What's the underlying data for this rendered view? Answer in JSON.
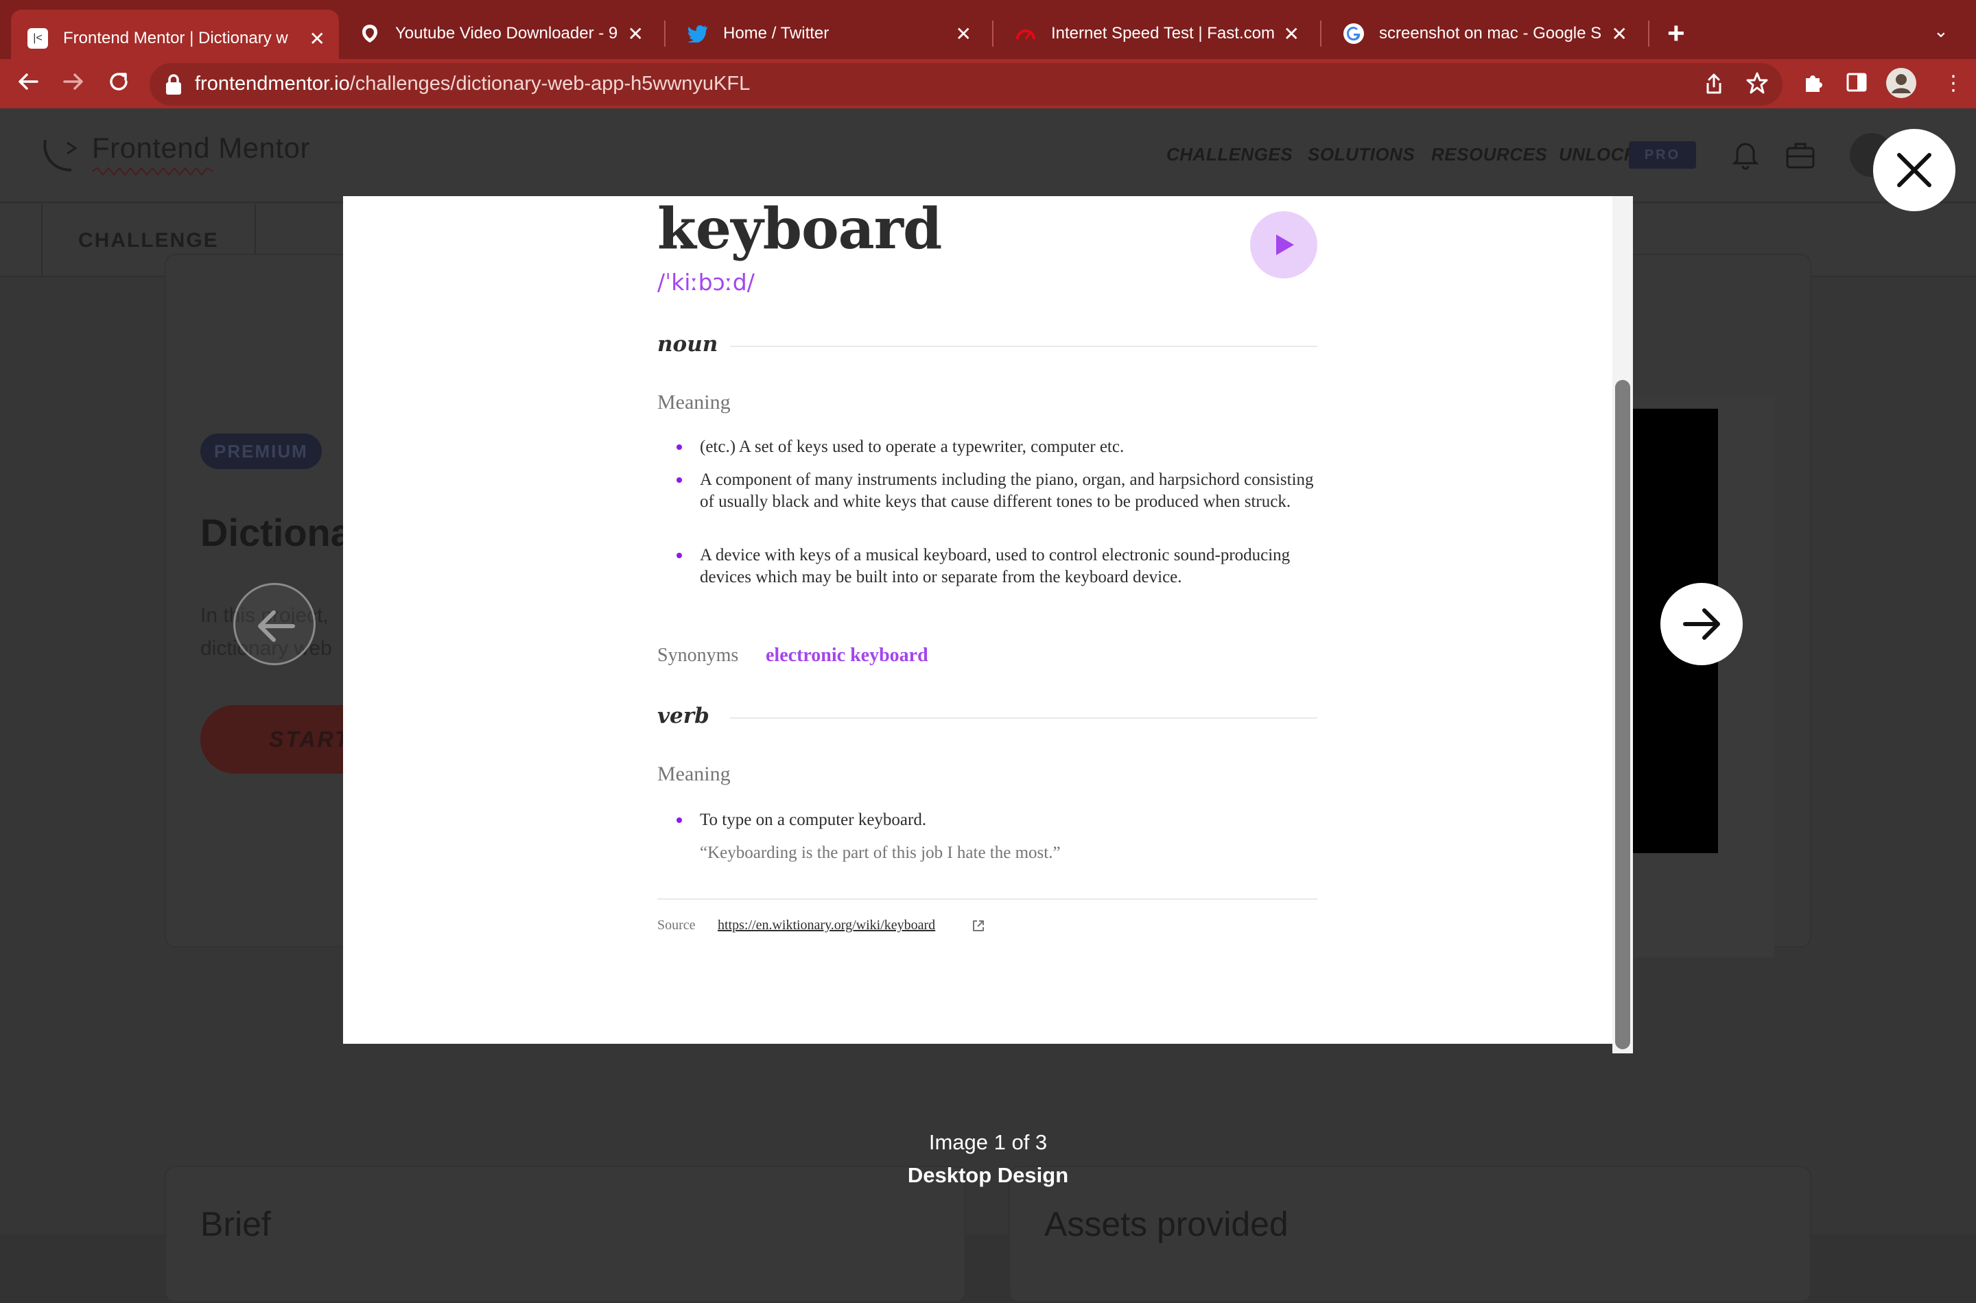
{
  "browser": {
    "tabs": [
      {
        "title": "Frontend Mentor | Dictionary w",
        "active": true,
        "favicon": "frontend-mentor-icon"
      },
      {
        "title": "Youtube Video Downloader - 9",
        "active": false,
        "favicon": "savefrom-icon"
      },
      {
        "title": "Home / Twitter",
        "active": false,
        "favicon": "twitter-bird-icon"
      },
      {
        "title": "Internet Speed Test | Fast.com",
        "active": false,
        "favicon": "fast-gauge-icon"
      },
      {
        "title": "screenshot on mac - Google Se",
        "active": false,
        "favicon": "google-g-icon"
      }
    ],
    "url_host": "frontendmentor.io",
    "url_path": "/challenges/dictionary-web-app-h5wwnyuKFL",
    "colors": {
      "tabbar": "#7e1f1d",
      "toolbar": "#a52c28"
    }
  },
  "site": {
    "brand": "Frontend Mentor",
    "nav": [
      "CHALLENGES",
      "SOLUTIONS",
      "RESOURCES",
      "UNLOCK"
    ],
    "pro_badge": "PRO",
    "subnav_tab": "CHALLENGE",
    "premium_badge": "PREMIUM",
    "title_partial": "Dictiona",
    "desc_line1": "In this project,",
    "desc_line2": "dictionary web",
    "start_button": "START",
    "brief_heading": "Brief",
    "assets_heading": "Assets provided"
  },
  "lightbox": {
    "word": "keyboard",
    "phonetic": "/ˈkiːbɔːd/",
    "sections": [
      {
        "part_of_speech": "noun",
        "meaning_heading": "Meaning",
        "definitions": [
          "(etc.) A set of keys used to operate a typewriter, computer etc.",
          "A component of many instruments including the piano, organ, and harpsichord consisting of usually black and white keys that cause different tones to be produced when struck.",
          "A device with keys of a musical keyboard, used to control electronic sound-producing devices which may be built into or separate from the keyboard device."
        ],
        "synonyms_label": "Synonyms",
        "synonyms": "electronic keyboard"
      },
      {
        "part_of_speech": "verb",
        "meaning_heading": "Meaning",
        "definitions": [
          "To type on a computer keyboard."
        ],
        "example": "“Keyboarding is the part of this job I hate the most.”"
      }
    ],
    "source_label": "Source",
    "source_url": "https://en.wiktionary.org/wiki/keyboard",
    "caption_count": "Image 1 of 3",
    "caption_title": "Desktop Design",
    "accent_color": "#a445ed"
  }
}
